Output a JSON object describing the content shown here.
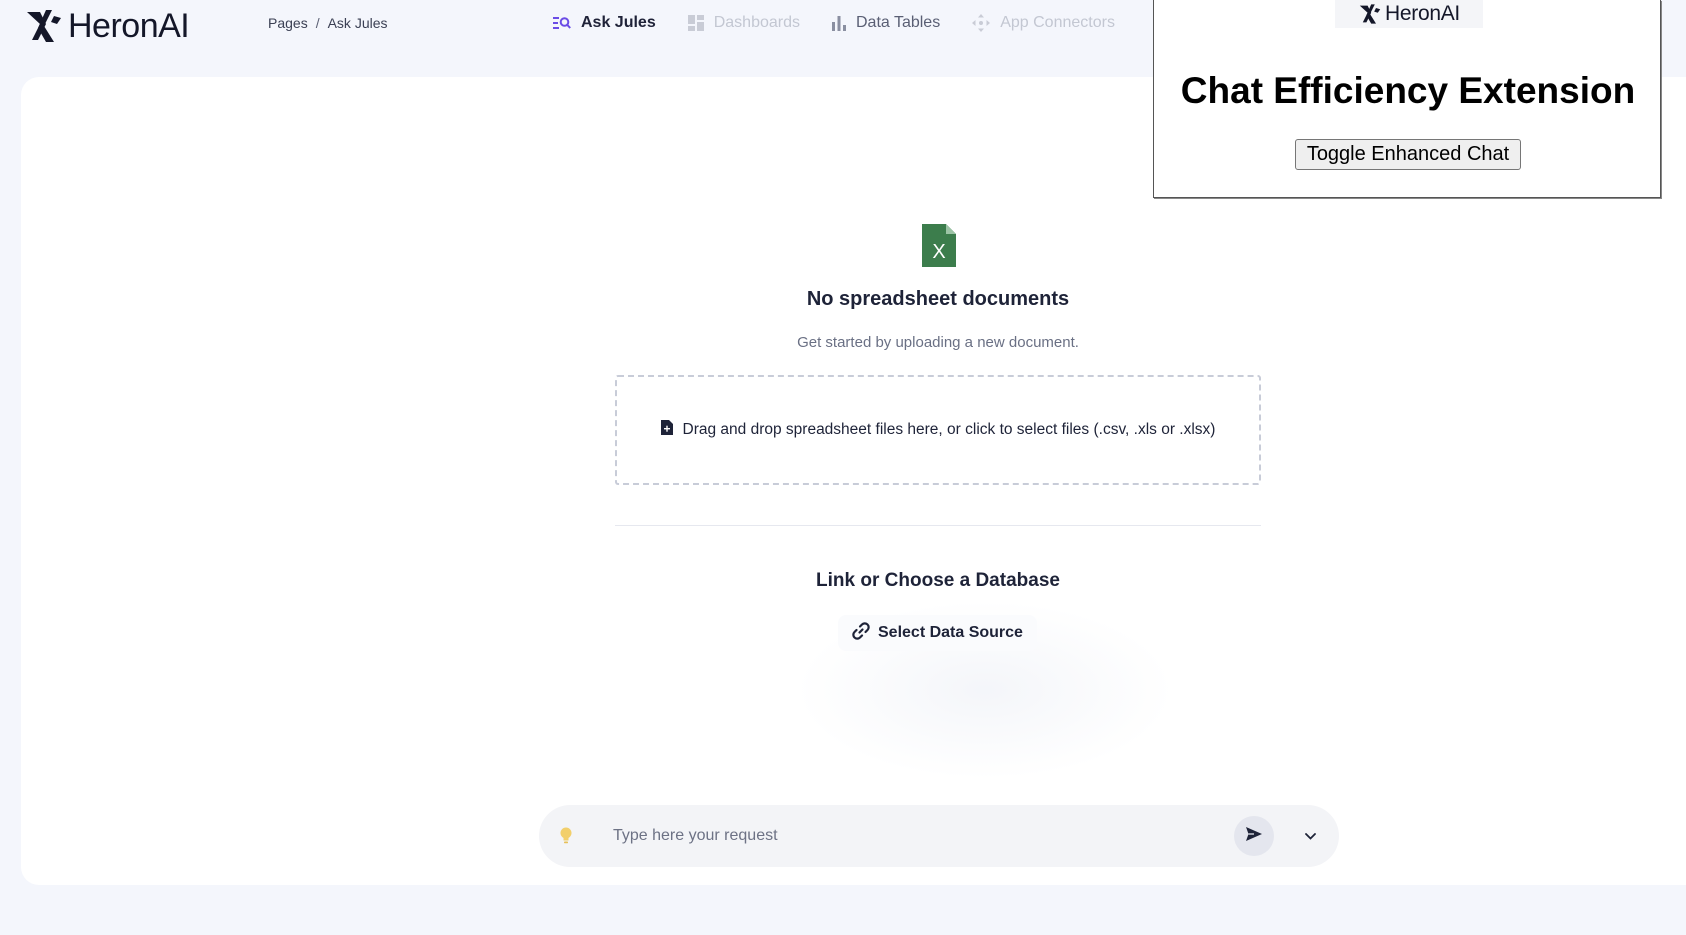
{
  "header": {
    "logo_text": "HeronAI",
    "breadcrumb": {
      "root": "Pages",
      "separator": "/",
      "current": "Ask Jules"
    },
    "nav": [
      {
        "label": "Ask Jules",
        "icon": "search-list-icon",
        "state": "active"
      },
      {
        "label": "Dashboards",
        "icon": "dashboard-grid-icon",
        "state": "faded"
      },
      {
        "label": "Data Tables",
        "icon": "bar-chart-icon",
        "state": "normal"
      },
      {
        "label": "App Connectors",
        "icon": "move-arrows-icon",
        "state": "faded"
      }
    ]
  },
  "main": {
    "file_icon": "excel-file-icon",
    "file_icon_letter": "X",
    "empty_title": "No spreadsheet documents",
    "empty_subtitle": "Get started by uploading a new document.",
    "dropzone_text": "Drag and drop spreadsheet files here, or click to select files (.csv, .xls or .xlsx)",
    "db_title": "Link or Choose a Database",
    "select_source_label": "Select Data Source"
  },
  "chat": {
    "placeholder": "Type here your request",
    "value": ""
  },
  "extension": {
    "logo_text": "HeronAI",
    "title": "Chat Efficiency Extension",
    "toggle_label": "Toggle Enhanced Chat"
  },
  "colors": {
    "accent_purple": "#6b4ce6",
    "excel_green": "#3c7d4c",
    "bulb_yellow": "#f2cf6b",
    "page_background": "#f4f6fc"
  }
}
